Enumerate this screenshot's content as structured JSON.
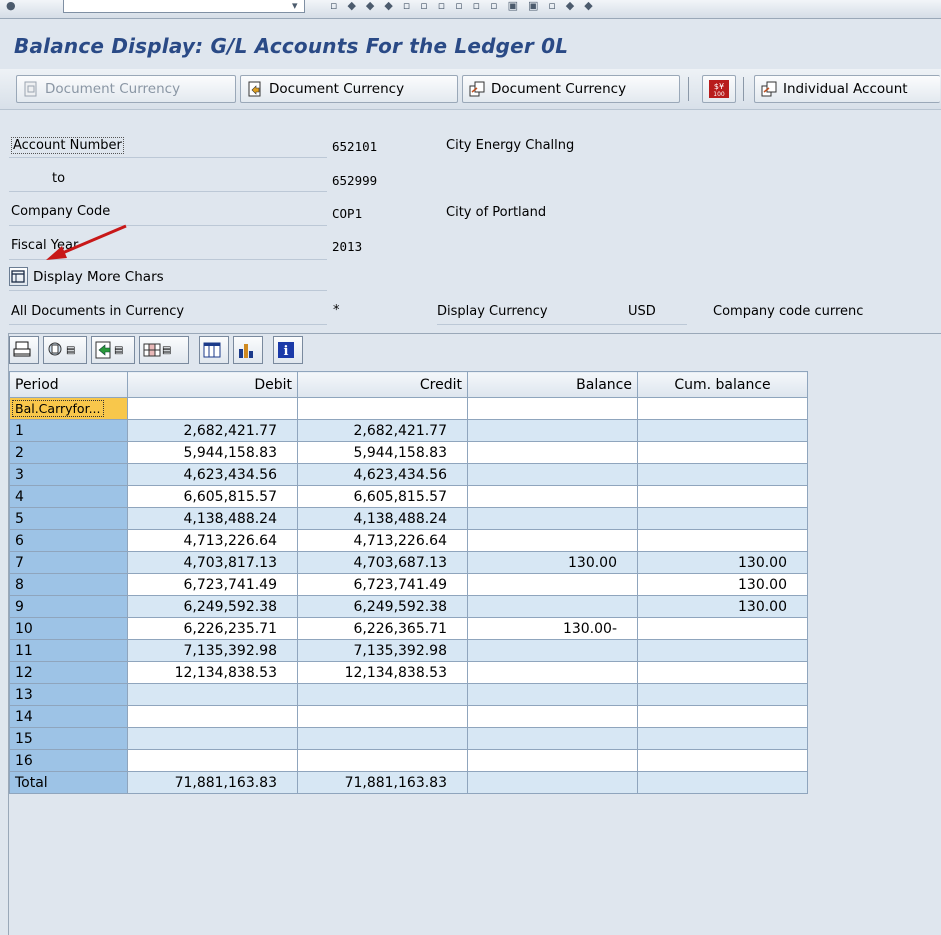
{
  "window": {
    "title": "Balance Display: G/L Accounts For the Ledger 0L"
  },
  "toolbar": {
    "buttons": [
      {
        "label": "Document Currency",
        "icon": "document-currency-icon",
        "enabled": false
      },
      {
        "label": "Document Currency",
        "icon": "document-export-icon",
        "enabled": true
      },
      {
        "label": "Document Currency",
        "icon": "document-compare-icon",
        "enabled": true
      },
      {
        "label": "",
        "icon": "currency-calculator-icon",
        "enabled": true
      },
      {
        "label": "Individual Account",
        "icon": "individual-account-icon",
        "enabled": true
      }
    ]
  },
  "header": {
    "account_number_label": "Account Number",
    "account_from": "652101",
    "account_from_desc": "City Energy Challng",
    "to_label": "to",
    "account_to": "652999",
    "company_code_label": "Company Code",
    "company_code": "COP1",
    "company_name": "City of Portland",
    "fiscal_year_label": "Fiscal Year",
    "fiscal_year": "2013",
    "display_more_label": "Display More Chars",
    "all_docs_label": "All Documents in Currency",
    "all_docs_value": "*",
    "display_currency_label": "Display Currency",
    "display_currency": "USD",
    "company_code_currency": "Company code currenc"
  },
  "grid": {
    "toolbar_icons": [
      "print-icon",
      "details-icon",
      "export-icon",
      "layout-icon",
      "columns-icon",
      "chart-icon",
      "info-icon"
    ],
    "columns": [
      "Period",
      "Debit",
      "Credit",
      "Balance",
      "Cum. balance"
    ],
    "rows": [
      {
        "period": "Bal.Carryfor...",
        "debit": "",
        "credit": "",
        "balance": "",
        "cum": ""
      },
      {
        "period": "1",
        "debit": "2,682,421.77",
        "credit": "2,682,421.77",
        "balance": "",
        "cum": ""
      },
      {
        "period": "2",
        "debit": "5,944,158.83",
        "credit": "5,944,158.83",
        "balance": "",
        "cum": ""
      },
      {
        "period": "3",
        "debit": "4,623,434.56",
        "credit": "4,623,434.56",
        "balance": "",
        "cum": ""
      },
      {
        "period": "4",
        "debit": "6,605,815.57",
        "credit": "6,605,815.57",
        "balance": "",
        "cum": ""
      },
      {
        "period": "5",
        "debit": "4,138,488.24",
        "credit": "4,138,488.24",
        "balance": "",
        "cum": ""
      },
      {
        "period": "6",
        "debit": "4,713,226.64",
        "credit": "4,713,226.64",
        "balance": "",
        "cum": ""
      },
      {
        "period": "7",
        "debit": "4,703,817.13",
        "credit": "4,703,687.13",
        "balance": "130.00",
        "cum": "130.00"
      },
      {
        "period": "8",
        "debit": "6,723,741.49",
        "credit": "6,723,741.49",
        "balance": "",
        "cum": "130.00"
      },
      {
        "period": "9",
        "debit": "6,249,592.38",
        "credit": "6,249,592.38",
        "balance": "",
        "cum": "130.00"
      },
      {
        "period": "10",
        "debit": "6,226,235.71",
        "credit": "6,226,365.71",
        "balance": "130.00-",
        "cum": ""
      },
      {
        "period": "11",
        "debit": "7,135,392.98",
        "credit": "7,135,392.98",
        "balance": "",
        "cum": ""
      },
      {
        "period": "12",
        "debit": "12,134,838.53",
        "credit": "12,134,838.53",
        "balance": "",
        "cum": ""
      },
      {
        "period": "13",
        "debit": "",
        "credit": "",
        "balance": "",
        "cum": ""
      },
      {
        "period": "14",
        "debit": "",
        "credit": "",
        "balance": "",
        "cum": ""
      },
      {
        "period": "15",
        "debit": "",
        "credit": "",
        "balance": "",
        "cum": ""
      },
      {
        "period": "16",
        "debit": "",
        "credit": "",
        "balance": "",
        "cum": ""
      },
      {
        "period": "Total",
        "debit": "71,881,163.83",
        "credit": "71,881,163.83",
        "balance": "",
        "cum": ""
      }
    ]
  },
  "colors": {
    "title": "#2a4a86",
    "period_col": "#9dc3e6",
    "carry_forward": "#f8c74b",
    "row_alt": "#d7e7f4",
    "arrow": "#c81818"
  }
}
